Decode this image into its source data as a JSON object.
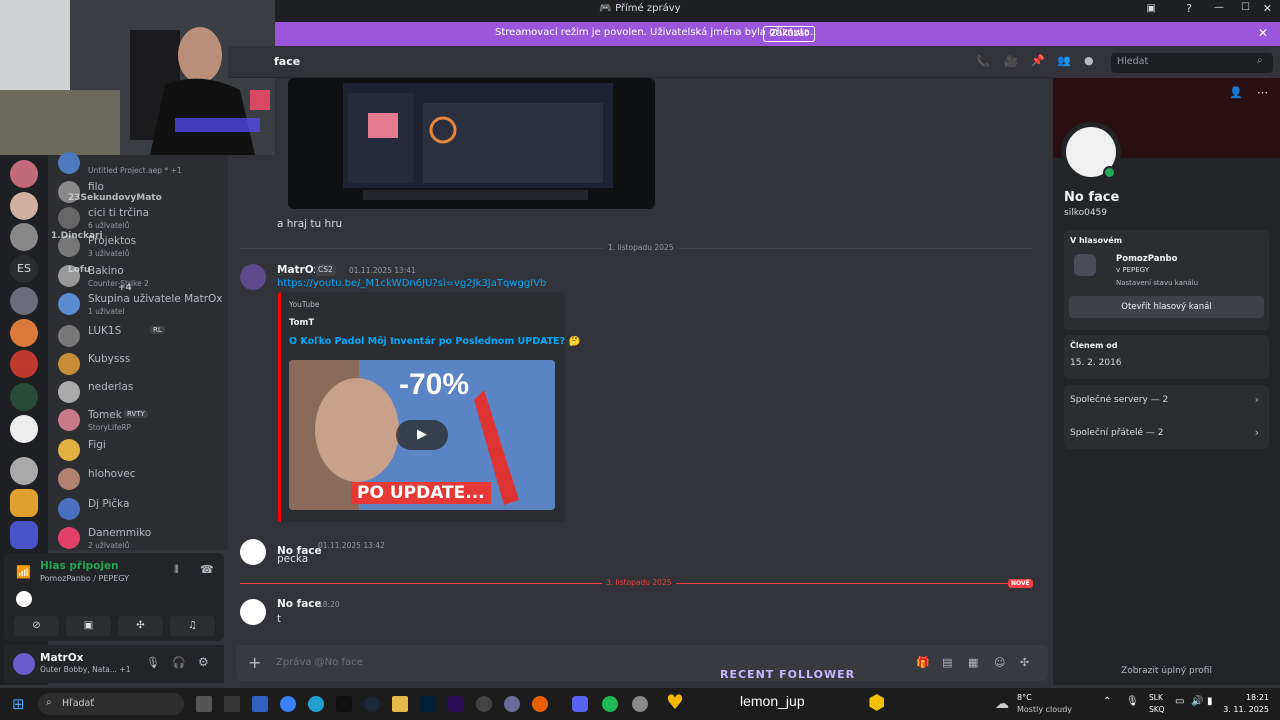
{
  "titlebar": {
    "title": "Přímé zprávy"
  },
  "banner": {
    "text": "Streamovací režim je povolen. Uživatelská jména byla oříznuta.",
    "button": "Zakázat"
  },
  "chat": {
    "channel": "face",
    "search_placeholder": "Hledat"
  },
  "dm_list": [
    {
      "name": "",
      "sub": "Untitled Project.aep * +1"
    },
    {
      "name": "filo",
      "sub": ""
    },
    {
      "name": "cici ti trčina",
      "sub": "6 uživatelů"
    },
    {
      "name": "Projektos",
      "sub": "3 uživatelů"
    },
    {
      "name": "Bakino",
      "sub": "Counter-Strike 2"
    },
    {
      "name": "Skupina uživatele MatrOx",
      "sub": "1 uživatel"
    },
    {
      "name": "LUK1S",
      "sub": ""
    },
    {
      "name": "Kubysss",
      "sub": ""
    },
    {
      "name": "nederlas",
      "sub": ""
    },
    {
      "name": "Tomek",
      "sub": "StoryLifeRP"
    },
    {
      "name": "Figi",
      "sub": ""
    },
    {
      "name": "hlohovec",
      "sub": ""
    },
    {
      "name": "Dj Pička",
      "sub": ""
    },
    {
      "name": "Danemmiko",
      "sub": "2 uživatelů"
    }
  ],
  "overlay_names": [
    "23SekundovyMato",
    "1.Dinckari",
    "Lofu",
    "+4"
  ],
  "dm_badges": {
    "rl": "RL",
    "rvty": "RVTY"
  },
  "server_es": "ES",
  "voice": {
    "status": "Hlas připojen",
    "location": "PomozPanbo / PEPEGY"
  },
  "user": {
    "name": "MatrOx",
    "status": "Outer Bobby, Nata... +1"
  },
  "messages": {
    "m0_text": "a hraj tu hru",
    "div1": "1. listopadu 2025",
    "m1_name": "MatrOx",
    "m1_tag": "CS2",
    "m1_time": "01.11.2025 13:41",
    "m1_link": "https://youtu.be/_M1ckWDn6JU?si=vg2Jk3JaTqwggIVb",
    "embed_provider": "YouTube",
    "embed_author": "TomT",
    "embed_title": "O Koľko Padol Môj Inventár po Poslednom UPDATE? 🤔",
    "thumb_top": "-70%",
    "thumb_bottom": "PO UPDATE...",
    "m2_name": "No face",
    "m2_time": "01.11.2025 13:42",
    "m2_text": "pecka",
    "div2": "3. listopadu 2025",
    "div2_badge": "NOVÉ",
    "m3_name": "No face",
    "m3_time": "18:20",
    "m3_text": "t"
  },
  "composer": {
    "placeholder": "Zpráva @No face"
  },
  "overlay": {
    "recent_follower": "RECENT FOLLOWER",
    "follower_name": "lemon_jup"
  },
  "profile": {
    "display_name": "No face",
    "username": "silko0459",
    "voice_header": "V hlasovém",
    "voice_server": "PomozPanbo",
    "voice_channel": "v PEPEGY",
    "voice_status": "Nastavení stavu kanálu",
    "voice_button": "Otevřít hlasový kanál",
    "member_header": "Členem od",
    "member_date": "15. 2. 2016",
    "mutual_servers": "Společné servery — 2",
    "mutual_friends": "Společní přátelé — 2",
    "full_profile": "Zobrazit úplný profil"
  },
  "taskbar": {
    "search": "Hľadať",
    "weather_temp": "8°C",
    "weather_desc": "Mostly cloudy",
    "lang_top": "SLK",
    "lang_bottom": "SKQ",
    "time": "18:21",
    "date": "3. 11. 2025"
  },
  "colors": {
    "accent": "#5865f2",
    "banner": "#9a55db",
    "online": "#23a55a",
    "new": "#f23f43",
    "link": "#00a8fc"
  }
}
